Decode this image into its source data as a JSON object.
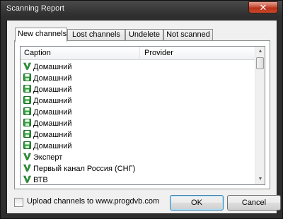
{
  "window": {
    "title": "Scanning Report",
    "close_glyph": "✕"
  },
  "tabs": [
    {
      "label": "New channels",
      "active": true
    },
    {
      "label": "Lost channels",
      "active": false
    },
    {
      "label": "Undelete",
      "active": false
    },
    {
      "label": "Not scanned",
      "active": false
    }
  ],
  "list": {
    "columns": {
      "caption": "Caption",
      "provider": "Provider"
    },
    "rows": [
      {
        "icon": "tv-v-icon",
        "caption": "Домашний",
        "provider": ""
      },
      {
        "icon": "floppy-icon",
        "caption": "Домашний",
        "provider": ""
      },
      {
        "icon": "floppy-icon",
        "caption": "Домашний",
        "provider": ""
      },
      {
        "icon": "floppy-icon",
        "caption": "Домашний",
        "provider": ""
      },
      {
        "icon": "floppy-icon",
        "caption": "Домашний",
        "provider": ""
      },
      {
        "icon": "floppy-icon",
        "caption": "Домашний",
        "provider": ""
      },
      {
        "icon": "floppy-icon",
        "caption": "Домашний",
        "provider": ""
      },
      {
        "icon": "floppy-icon",
        "caption": "Домашний",
        "provider": ""
      },
      {
        "icon": "tv-v-icon",
        "caption": "Эксперт",
        "provider": ""
      },
      {
        "icon": "tv-v-icon",
        "caption": "Первый канал Россия (СНГ)",
        "provider": ""
      },
      {
        "icon": "tv-v-icon",
        "caption": "ВТВ",
        "provider": ""
      }
    ]
  },
  "footer": {
    "upload_label": "Upload channels to www.progdvb.com",
    "upload_checked": false,
    "ok_label": "OK",
    "cancel_label": "Cancel"
  },
  "colors": {
    "icon_green": "#2e9c3a",
    "title_bar": "#3a3a3a",
    "close_red": "#c7503a"
  }
}
